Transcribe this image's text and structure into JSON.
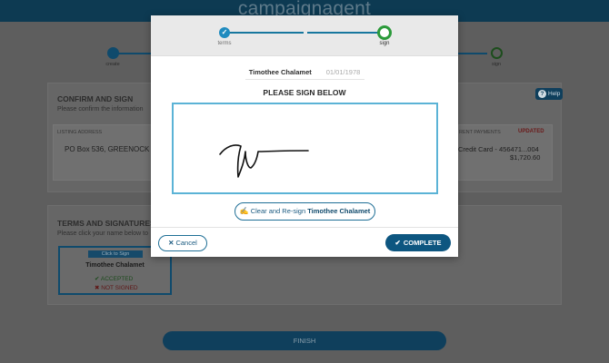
{
  "app": {
    "logo": "campaignagent"
  },
  "background": {
    "steps": {
      "left_label": "create",
      "right_label": "sign"
    },
    "confirm": {
      "title": "CONFIRM AND SIGN",
      "subtitle": "Please confirm the information",
      "listing_label": "LISTING ADDRESS",
      "address": "PO Box 536, GREENOCK",
      "payments_label": "RENT PAYMENTS",
      "updated": "UPDATED",
      "card": "Credit Card - 456471...004",
      "amount": "$1,720.60"
    },
    "help": {
      "label": "Help"
    },
    "terms": {
      "title": "TERMS AND SIGNATURES",
      "subtitle": "Please click your name below to",
      "card_tag": "Click to Sign",
      "card_name": "Timothee Chalamet",
      "accepted": "ACCEPTED",
      "not_signed": "NOT SIGNED"
    },
    "finish": "FINISH"
  },
  "modal": {
    "steps": {
      "terms": "terms",
      "sign": "sign"
    },
    "signer": {
      "name": "Timothee Chalamet",
      "dob": "01/01/1978"
    },
    "heading": "PLEASE SIGN BELOW",
    "resign": {
      "prefix": "Clear and Re-sign",
      "name": "Timothee Chalamet"
    },
    "cancel": "Cancel",
    "complete": "COMPLETE"
  },
  "colors": {
    "accent": "#0d5680",
    "pad_border": "#5bb3d6",
    "current_step": "#2b9a3a"
  }
}
